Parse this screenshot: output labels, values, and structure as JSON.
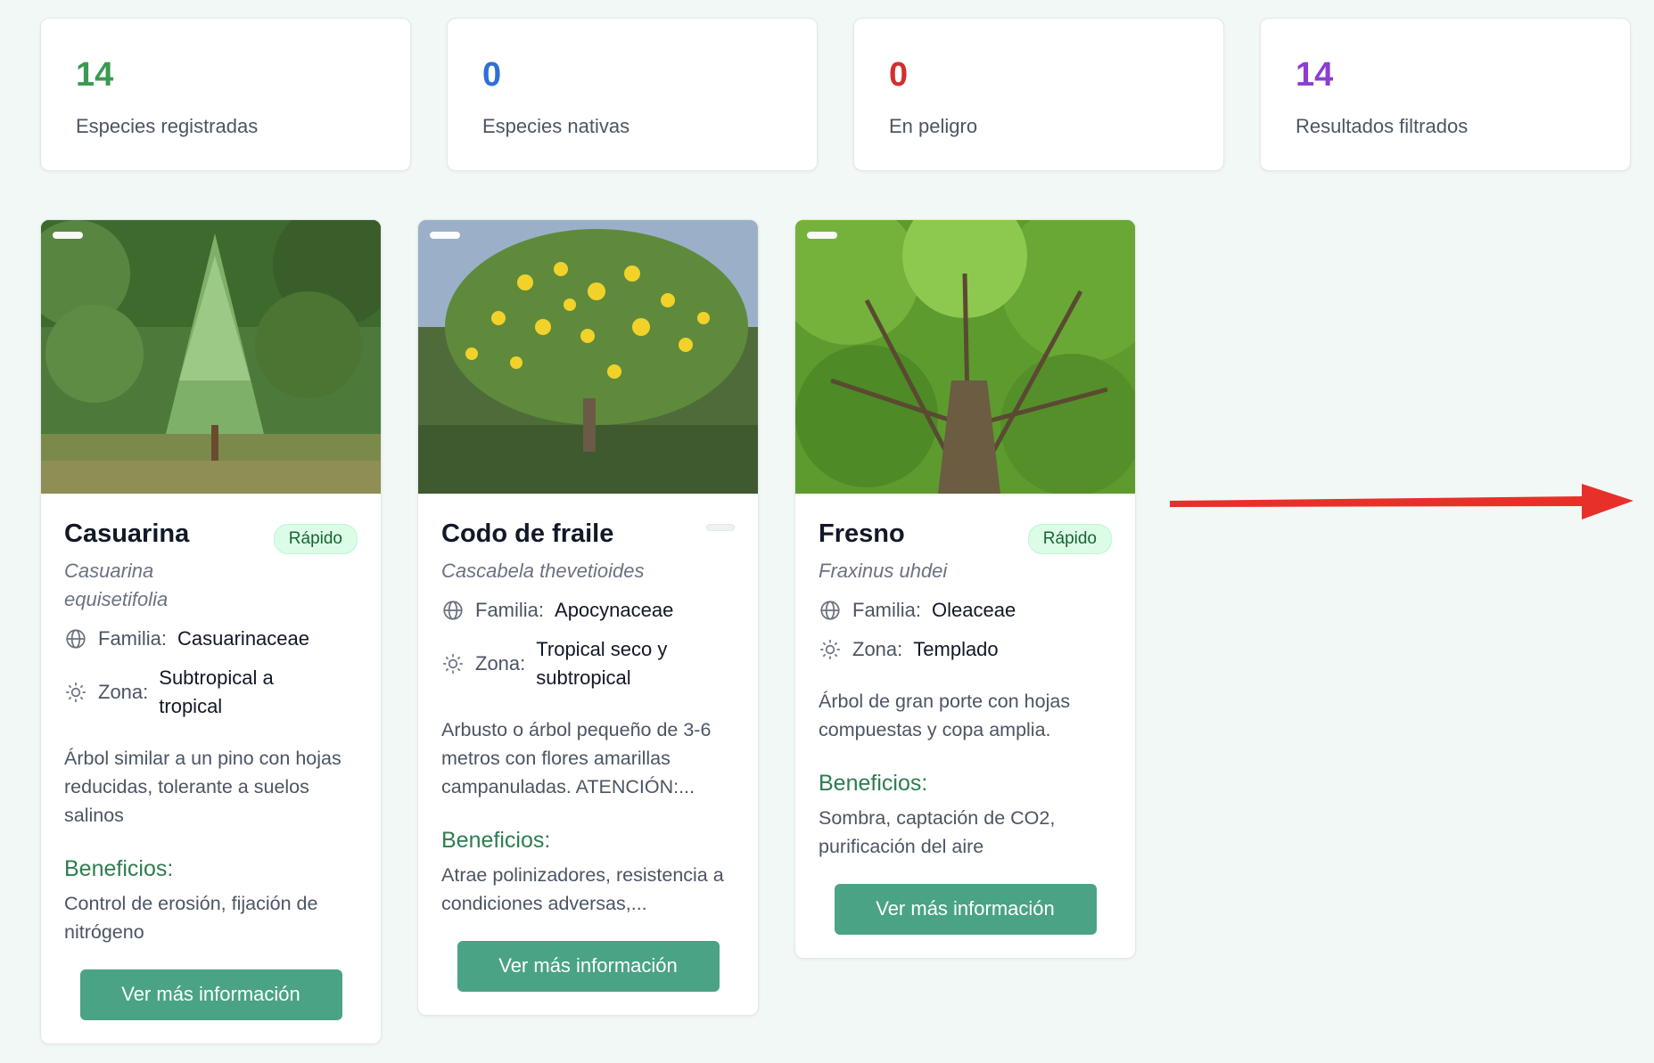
{
  "stats": [
    {
      "value": "14",
      "label": "Especies registradas",
      "color": "#3a9a4f"
    },
    {
      "value": "0",
      "label": "Especies nativas",
      "color": "#2f6fd6"
    },
    {
      "value": "0",
      "label": "En peligro",
      "color": "#d12f2f"
    },
    {
      "value": "14",
      "label": "Resultados filtrados",
      "color": "#8a3fd1"
    }
  ],
  "cards": [
    {
      "name": "Casuarina",
      "scientific": "Casuarina equisetifolia",
      "growth": "Rápido",
      "family_label": "Familia:",
      "family": "Casuarinaceae",
      "zone_label": "Zona:",
      "zone": "Subtropical a tropical",
      "description": "Árbol similar a un pino con hojas reducidas, tolerante a suelos salinos",
      "benefits_title": "Beneficios:",
      "benefits": "Control de erosión, fijación de nitrógeno",
      "button": "Ver más información"
    },
    {
      "name": "Codo de fraile",
      "scientific": "Cascabela thevetioides",
      "growth": "",
      "family_label": "Familia:",
      "family": "Apocynaceae",
      "zone_label": "Zona:",
      "zone": "Tropical seco y subtropical",
      "description": "Arbusto o árbol pequeño de 3-6 metros con flores amarillas campanuladas. ATENCIÓN:...",
      "benefits_title": "Beneficios:",
      "benefits": "Atrae polinizadores, resistencia a condiciones adversas,...",
      "button": "Ver más información"
    },
    {
      "name": "Fresno",
      "scientific": "Fraxinus uhdei",
      "growth": "Rápido",
      "family_label": "Familia:",
      "family": "Oleaceae",
      "zone_label": "Zona:",
      "zone": "Templado",
      "description": "Árbol de gran porte con hojas compuestas y copa amplia.",
      "benefits_title": "Beneficios:",
      "benefits": "Sombra, captación de CO2, purificación del aire",
      "button": "Ver más información"
    }
  ],
  "annotation_arrow_color": "#e8302a",
  "icons": {
    "family": "globe-icon",
    "zone": "sun-icon"
  }
}
